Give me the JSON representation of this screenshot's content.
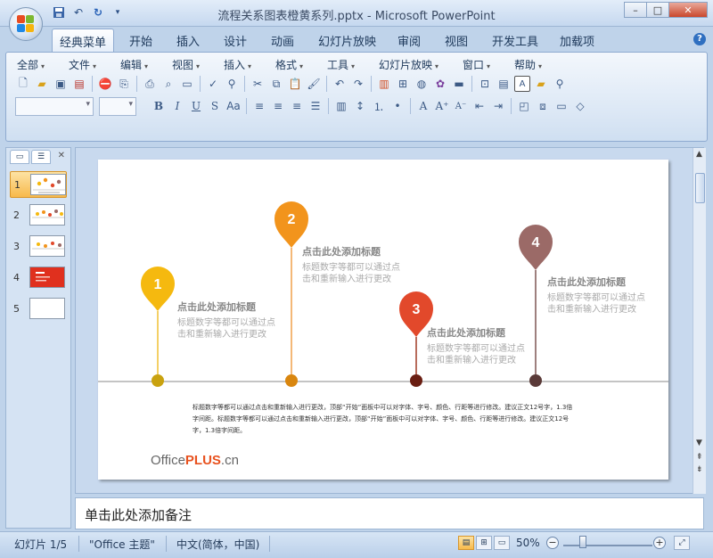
{
  "window": {
    "title": "流程关系图表橙黄系列.pptx - Microsoft PowerPoint",
    "min_glyph": "–",
    "max_glyph": "□",
    "close_glyph": "✕"
  },
  "quick_access": [
    "save-icon",
    "undo-icon",
    "redo-icon",
    "customize-icon"
  ],
  "ribbon_tabs": [
    "经典菜单",
    "开始",
    "插入",
    "设计",
    "动画",
    "幻灯片放映",
    "审阅",
    "视图",
    "开发工具",
    "加载项"
  ],
  "active_tab": "经典菜单",
  "classic_menu": [
    "全部",
    "文件",
    "编辑",
    "视图",
    "插入",
    "格式",
    "工具",
    "幻灯片放映",
    "窗口",
    "帮助"
  ],
  "format_buttons": {
    "bold": "B",
    "italic": "I",
    "underline": "U",
    "shadow": "S",
    "font_size_a": "A"
  },
  "slide_panel": {
    "thumbnails": [
      {
        "number": "1",
        "selected": true
      },
      {
        "number": "2",
        "selected": false
      },
      {
        "number": "3",
        "selected": false
      },
      {
        "number": "4",
        "selected": false
      },
      {
        "number": "5",
        "selected": false
      }
    ]
  },
  "slide": {
    "markers": [
      {
        "number": "1",
        "color": "#f5b90f",
        "line_color": "#f0c132",
        "dot_color": "#c9a20f",
        "title": "点击此处添加标题",
        "body": "标题数字等都可以通过点击和重新输入进行更改"
      },
      {
        "number": "2",
        "color": "#f2941c",
        "line_color": "#f0a04a",
        "dot_color": "#d9860f",
        "title": "点击此处添加标题",
        "body": "标题数字等都可以通过点击和重新输入进行更改"
      },
      {
        "number": "3",
        "color": "#e2492b",
        "line_color": "#a03a25",
        "dot_color": "#6a1e12",
        "title": "点击此处添加标题",
        "body": "标题数字等都可以通过点击和重新输入进行更改"
      },
      {
        "number": "4",
        "color": "#9b6a67",
        "line_color": "#7d5553",
        "dot_color": "#5a3a38",
        "title": "点击此处添加标题",
        "body": "标题数字等都可以通过点击和重新输入进行更改"
      }
    ],
    "paragraph": "标题数字等都可以通过点击和重新输入进行更改，顶部“开始”面板中可以对字体、字号、颜色、行距等进行修改。建议正文12号字，1.3倍字间距。标题数字等都可以通过点击和重新输入进行更改，顶部“开始”面板中可以对字体、字号、颜色、行距等进行修改。建议正文12号字，1.3倍字间距。",
    "logo_prefix": "Office",
    "logo_highlight": "PLUS",
    "logo_suffix": ".cn"
  },
  "notes_placeholder": "单击此处添加备注",
  "status": {
    "slide_counter": "幻灯片 1/5",
    "theme": "\"Office 主题\"",
    "language": "中文(简体，中国)",
    "zoom": "50%",
    "zoom_level": 0.5
  }
}
